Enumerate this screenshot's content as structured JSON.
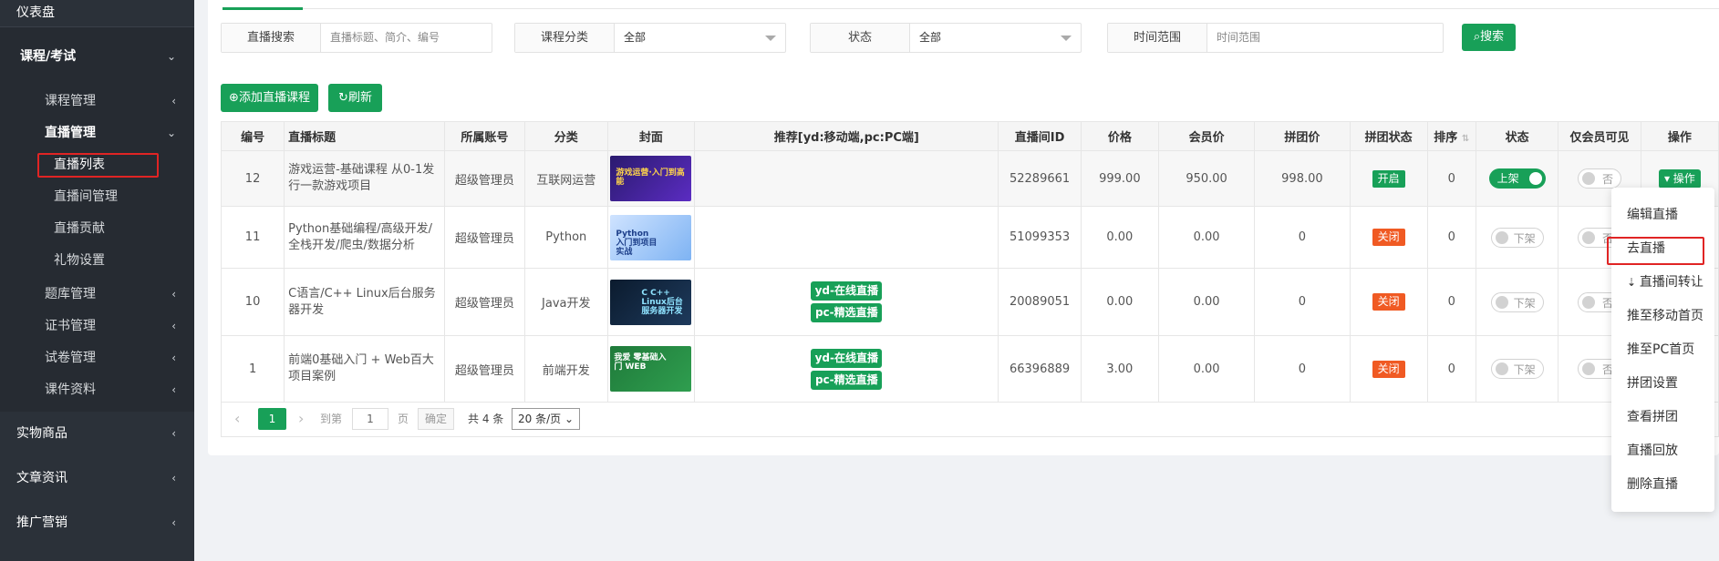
{
  "sidebar": {
    "top": "仪表盘",
    "group": {
      "label": "课程/考试",
      "items": [
        {
          "label": "课程管理",
          "chev": "‹"
        },
        {
          "label": "直播管理",
          "chev": "⌄",
          "open": true
        },
        {
          "label": "直播列表",
          "leaf": true,
          "active": true
        },
        {
          "label": "直播间管理",
          "leaf": true
        },
        {
          "label": "直播贡献",
          "leaf": true
        },
        {
          "label": "礼物设置",
          "leaf": true
        },
        {
          "label": "题库管理",
          "chev": "‹"
        },
        {
          "label": "证书管理",
          "chev": "‹"
        },
        {
          "label": "试卷管理",
          "chev": "‹"
        },
        {
          "label": "课件资料",
          "chev": "‹"
        }
      ]
    },
    "main": [
      {
        "label": "实物商品"
      },
      {
        "label": "文章资讯"
      },
      {
        "label": "推广营销"
      }
    ]
  },
  "search": {
    "fields": [
      {
        "label": "直播搜索",
        "placeholder": "直播标题、简介、编号"
      },
      {
        "label": "课程分类",
        "value": "全部"
      },
      {
        "label": "状态",
        "value": "全部"
      },
      {
        "label": "时间范围",
        "placeholder": "时间范围"
      }
    ],
    "button": "搜索"
  },
  "toolbar": {
    "add": "添加直播课程",
    "refresh": "刷新"
  },
  "table": {
    "headers": [
      "编号",
      "直播标题",
      "所属账号",
      "分类",
      "封面",
      "推荐[yd:移动端,pc:PC端]",
      "直播间ID",
      "价格",
      "会员价",
      "拼团价",
      "拼团状态",
      "排序",
      "状态",
      "仅会员可见",
      "操作"
    ],
    "rows": [
      {
        "id": "12",
        "title": "游戏运营-基础课程 从0-1发行一款游戏项目",
        "account": "超级管理员",
        "category": "互联网运营",
        "cover_text": "游戏运营·入门到高能",
        "rec": [],
        "room": "52289661",
        "price": "999.00",
        "vip": "950.00",
        "group": "998.00",
        "group_status": "开启",
        "sort": "0",
        "status": "上架",
        "vip_only": "否",
        "op": "操作"
      },
      {
        "id": "11",
        "title": "Python基础编程/高级开发/全栈开发/爬虫/数据分析",
        "account": "超级管理员",
        "category": "Python",
        "cover_text": "Python 入门到项目实战",
        "rec": [],
        "room": "51099353",
        "price": "0.00",
        "vip": "0.00",
        "group": "0",
        "group_status": "关闭",
        "sort": "0",
        "status": "下架",
        "vip_only": "否"
      },
      {
        "id": "10",
        "title": "C语言/C++ Linux后台服务器开发",
        "account": "超级管理员",
        "category": "Java开发",
        "cover_text": "C C++ Linux后台服务器开发",
        "rec": [
          "yd-在线直播",
          "pc-精选直播"
        ],
        "room": "20089051",
        "price": "0.00",
        "vip": "0.00",
        "group": "0",
        "group_status": "关闭",
        "sort": "0",
        "status": "下架",
        "vip_only": "否"
      },
      {
        "id": "1",
        "title": "前端0基础入门 + Web百大项目案例",
        "account": "超级管理员",
        "category": "前端开发",
        "cover_text": "我爱 零基础入门 WEB",
        "rec": [
          "yd-在线直播",
          "pc-精选直播"
        ],
        "room": "66396889",
        "price": "3.00",
        "vip": "0.00",
        "group": "0",
        "group_status": "关闭",
        "sort": "0",
        "status": "下架",
        "vip_only": "否"
      }
    ]
  },
  "pager": {
    "current": "1",
    "goto": "到第",
    "page_input": "1",
    "page_unit": "页",
    "confirm": "确定",
    "total": "共 4 条",
    "per_page": "20 条/页"
  },
  "dropdown": {
    "items": [
      "编辑直播",
      "去直播",
      "直播间转让",
      "推至移动首页",
      "推至PC首页",
      "拼团设置",
      "查看拼团",
      "直播回放",
      "删除直播"
    ]
  },
  "colors": {
    "primary": "#18a058",
    "danger": "#f05a23",
    "sidebar": "#2b3139",
    "highlight": "#e02424"
  }
}
